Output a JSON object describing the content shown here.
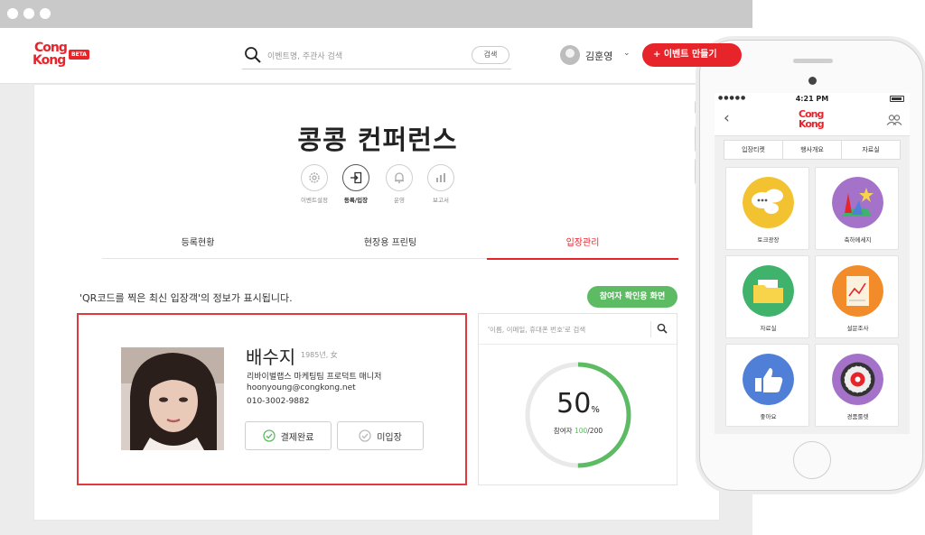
{
  "header": {
    "logo_top": "Cong",
    "logo_bottom": "Kong",
    "logo_badge": "BETA",
    "search_placeholder": "이벤트명, 주관사 검색",
    "search_button": "검색",
    "user_name": "김훈영",
    "user_chevron": "⌄",
    "create_button": "+ 이벤트 만들기"
  },
  "page": {
    "title": "콩콩 컨퍼런스",
    "subnav": [
      {
        "label": "이벤트설정",
        "icon": "gear-icon"
      },
      {
        "label": "등록/입장",
        "icon": "enter-icon",
        "active": true
      },
      {
        "label": "운영",
        "icon": "bell-icon"
      },
      {
        "label": "보고서",
        "icon": "bar-chart-icon"
      }
    ],
    "tabs": [
      {
        "label": "등록현황"
      },
      {
        "label": "현장용 프린팅"
      },
      {
        "label": "입장관리",
        "active": true
      }
    ],
    "notice": "'QR코드를 찍은 최신 입장객'의 정보가 표시됩니다.",
    "check_screen_button": "참여자 확인용 화면"
  },
  "attendee": {
    "name": "배수지",
    "meta": "1985년, 女",
    "role": "리바이벌랩스 마케팅팀 프로덕트 매니저",
    "email": "hoonyoung@congkong.net",
    "phone": "010-3002-9882",
    "paid_button": "결제완료",
    "not_entered_button": "미입장"
  },
  "checkin": {
    "search_placeholder": "'이름, 이메일, 휴대폰 번호'로 검색",
    "percent_value": "50",
    "percent_sign": "%",
    "percent_fraction": 0.5,
    "attend_label": "참여자",
    "attend_count": "100",
    "attend_total": "/200"
  },
  "colors": {
    "brand": "#e8242b",
    "green": "#5dbb63"
  },
  "phone": {
    "time": "4:21 PM",
    "signal": "●●●●●",
    "back": "‹",
    "logo_top": "Cong",
    "logo_bottom": "Kong",
    "segments": [
      "입장티켓",
      "행사개요",
      "자료실"
    ],
    "tiles": [
      {
        "label": "토크광장",
        "icon": "speech-bubbles-icon",
        "color": "#f2c230"
      },
      {
        "label": "축하메세지",
        "icon": "celebration-icon",
        "color": "#a572c9"
      },
      {
        "label": "자료실",
        "icon": "folder-icon",
        "color": "#3fb26b"
      },
      {
        "label": "설문조사",
        "icon": "survey-chart-icon",
        "color": "#f28b2a"
      },
      {
        "label": "좋아요",
        "icon": "thumbs-up-icon",
        "color": "#4f7fd6"
      },
      {
        "label": "경품룰렛",
        "icon": "roulette-icon",
        "color": "#a572c9"
      }
    ]
  }
}
